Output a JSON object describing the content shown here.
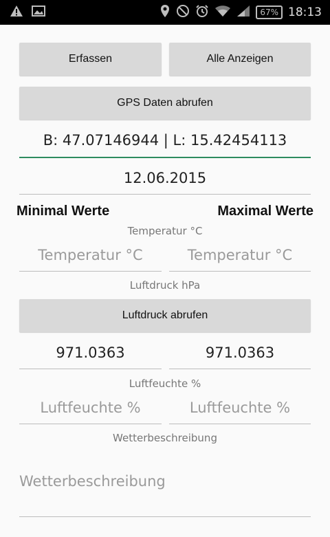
{
  "status_bar": {
    "icons_left": [
      "warning-icon",
      "image-icon"
    ],
    "icons_right": [
      "location-icon",
      "do-not-disturb-icon",
      "alarm-icon",
      "wifi-icon",
      "signal-icon"
    ],
    "battery": "67",
    "time": "18:13"
  },
  "buttons": {
    "record": "Erfassen",
    "show_all": "Alle Anzeigen",
    "gps": "GPS Daten abrufen",
    "pressure": "Luftdruck abrufen"
  },
  "gps_field": {
    "value": "B: 47.07146944 | L: 15.42454113"
  },
  "date_field": {
    "value": "12.06.2015"
  },
  "headings": {
    "min": "Minimal Werte",
    "max": "Maximal Werte"
  },
  "temperature": {
    "label": "Temperatur °C",
    "min_placeholder": "Temperatur °C",
    "max_placeholder": "Temperatur °C"
  },
  "pressure": {
    "label": "Luftdruck hPa",
    "min_value": "971.0363",
    "max_value": "971.0363"
  },
  "humidity": {
    "label": "Luftfeuchte %",
    "min_placeholder": "Luftfeuchte %",
    "max_placeholder": "Luftfeuchte %"
  },
  "weather": {
    "label": "Wetterbeschreibung",
    "placeholder": "Wetterbeschreibung"
  },
  "colors": {
    "accent": "#2e8b5f",
    "button_bg": "#d9d9d9",
    "status_bar": "#000000"
  }
}
